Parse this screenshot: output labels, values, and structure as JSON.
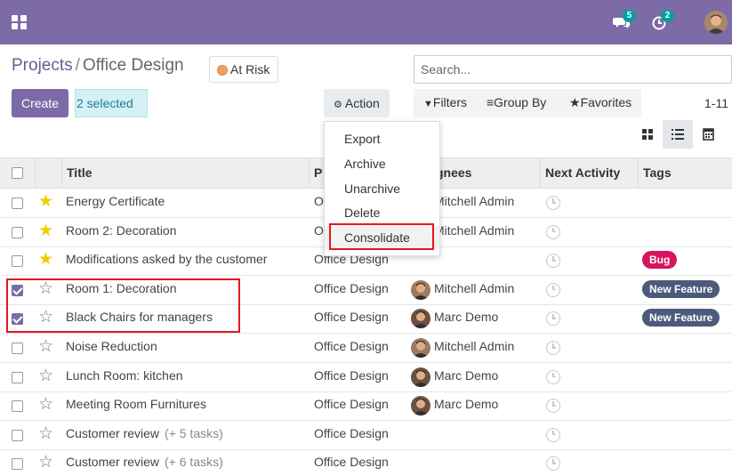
{
  "navbar": {
    "chat_badge": "5",
    "activity_badge": "2",
    "brand_color": "#7c6ba6"
  },
  "breadcrumb": {
    "parent": "Projects",
    "separator": "/",
    "current": "Office Design"
  },
  "status_button": {
    "label": "At Risk",
    "dot_color": "#f0a05a"
  },
  "search": {
    "placeholder": "Search..."
  },
  "toolbar": {
    "create_label": "Create",
    "selected_label": "2 selected",
    "action_label": "Action",
    "filters_label": "Filters",
    "groupby_label": "Group By",
    "favorites_label": "Favorites",
    "pager": "1-11"
  },
  "action_menu": {
    "items": [
      "Export",
      "Archive",
      "Unarchive",
      "Delete",
      "Consolidate"
    ]
  },
  "table": {
    "columns": {
      "title": "Title",
      "project": "P",
      "assignees": "gnees",
      "next_activity": "Next Activity",
      "tags": "Tags"
    },
    "rows": [
      {
        "title": "Energy Certificate",
        "subtasks": "",
        "project": "O",
        "assignee": "Mitchell Admin",
        "tag": "",
        "starred": true,
        "checked": false
      },
      {
        "title": "Room 2: Decoration",
        "subtasks": "",
        "project": "O",
        "assignee": "Mitchell Admin",
        "tag": "",
        "starred": true,
        "checked": false
      },
      {
        "title": "Modifications asked by the customer",
        "subtasks": "",
        "project": "Office Design",
        "assignee": "",
        "tag": "Bug",
        "starred": true,
        "checked": false
      },
      {
        "title": "Room 1: Decoration",
        "subtasks": "",
        "project": "Office Design",
        "assignee": "Mitchell Admin",
        "tag": "New Feature",
        "starred": false,
        "checked": true
      },
      {
        "title": "Black Chairs for managers",
        "subtasks": "",
        "project": "Office Design",
        "assignee": "Marc Demo",
        "tag": "New Feature",
        "starred": false,
        "checked": true
      },
      {
        "title": "Noise Reduction",
        "subtasks": "",
        "project": "Office Design",
        "assignee": "Mitchell Admin",
        "tag": "",
        "starred": false,
        "checked": false
      },
      {
        "title": "Lunch Room: kitchen",
        "subtasks": "",
        "project": "Office Design",
        "assignee": "Marc Demo",
        "tag": "",
        "starred": false,
        "checked": false
      },
      {
        "title": "Meeting Room Furnitures",
        "subtasks": "",
        "project": "Office Design",
        "assignee": "Marc Demo",
        "tag": "",
        "starred": false,
        "checked": false
      },
      {
        "title": "Customer review",
        "subtasks": "(+ 5 tasks)",
        "project": "Office Design",
        "assignee": "",
        "tag": "",
        "starred": false,
        "checked": false
      },
      {
        "title": "Customer review",
        "subtasks": "(+ 6 tasks)",
        "project": "Office Design",
        "assignee": "",
        "tag": "",
        "starred": false,
        "checked": false
      }
    ]
  },
  "tag_colors": {
    "Bug": "#d6145f",
    "New Feature": "#4c5a7b"
  }
}
